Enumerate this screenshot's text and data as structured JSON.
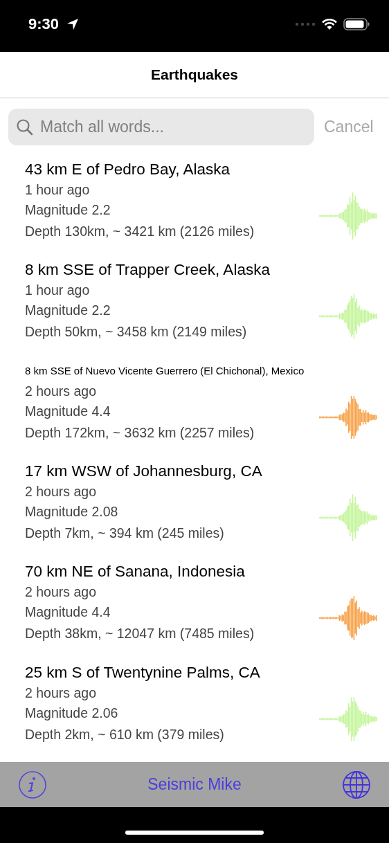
{
  "status_bar": {
    "time": "9:30"
  },
  "nav": {
    "title": "Earthquakes"
  },
  "search": {
    "placeholder": "Match all words...",
    "cancel": "Cancel"
  },
  "quakes": [
    {
      "place": "43 km E of Pedro Bay, Alaska",
      "time": "1 hour ago",
      "magnitude": "Magnitude 2.2",
      "depth": "Depth 130km, ~ 3421 km (2126 miles)",
      "color": "#c4f59a"
    },
    {
      "place": "8 km SSE of Trapper Creek, Alaska",
      "time": "1 hour ago",
      "magnitude": "Magnitude 2.2",
      "depth": "Depth 50km, ~ 3458 km (2149 miles)",
      "color": "#c4f59a"
    },
    {
      "place": "8 km SSE of Nuevo Vicente Guerrero (El Chichonal), Mexico",
      "time": "2 hours ago",
      "magnitude": "Magnitude 4.4",
      "depth": "Depth 172km, ~ 3632 km (2257 miles)",
      "color": "#f7a24a"
    },
    {
      "place": "17 km WSW of Johannesburg, CA",
      "time": "2 hours ago",
      "magnitude": "Magnitude 2.08",
      "depth": "Depth 7km, ~ 394 km (245 miles)",
      "color": "#c4f59a"
    },
    {
      "place": "70 km NE of Sanana, Indonesia",
      "time": "2 hours ago",
      "magnitude": "Magnitude 4.4",
      "depth": "Depth 38km, ~ 12047 km (7485 miles)",
      "color": "#f7a24a"
    },
    {
      "place": "25 km S of Twentynine Palms, CA",
      "time": "2 hours ago",
      "magnitude": "Magnitude 2.06",
      "depth": "Depth 2km, ~ 610 km (379 miles)",
      "color": "#c4f59a"
    }
  ],
  "toolbar": {
    "title": "Seismic Mike"
  }
}
